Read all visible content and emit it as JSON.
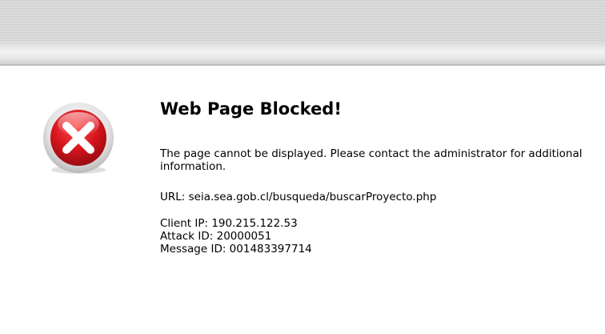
{
  "page": {
    "title": "Web Page Blocked!",
    "message": "The page cannot be displayed. Please contact the administrator for additional information.",
    "url_line": "URL: seia.sea.gob.cl/busqueda/buscarProyecto.php",
    "client_ip_line": "Client IP: 190.215.122.53",
    "attack_id_line": "Attack ID: 20000051",
    "message_id_line": "Message ID: 001483397714"
  },
  "icons": {
    "block": "error-x-icon"
  },
  "colors": {
    "icon_red": "#d4141d",
    "icon_ring": "#e6e6e6",
    "text": "#000000"
  }
}
